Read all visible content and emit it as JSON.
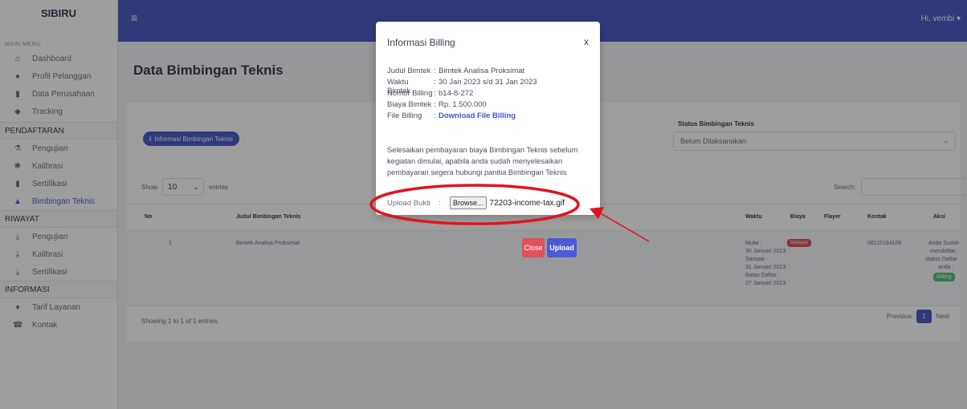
{
  "sidebar": {
    "brand": "SIBIRU",
    "main_menu_label": "MAIN MENU",
    "items_top": [
      {
        "label": "Dashboard",
        "icon": "home-icon"
      },
      {
        "label": "Profil Pelanggan",
        "icon": "user-icon"
      },
      {
        "label": "Data Perusahaan",
        "icon": "building-icon"
      },
      {
        "label": "Tracking",
        "icon": "map-pin-icon"
      }
    ],
    "section_pendaftaran": "PENDAFTARAN",
    "items_pendaftaran": [
      {
        "label": "Pengujian",
        "icon": "flask-icon"
      },
      {
        "label": "Kalibrasi",
        "icon": "cog-icon"
      },
      {
        "label": "Sertifikasi",
        "icon": "certificate-icon"
      },
      {
        "label": "Bimbingan Teknis",
        "icon": "graduation-cap-icon"
      }
    ],
    "section_riwayat": "RIWAYAT",
    "items_riwayat": [
      {
        "label": "Pengujian",
        "icon": "download-icon"
      },
      {
        "label": "Kalibrasi",
        "icon": "download-icon"
      },
      {
        "label": "Sertifikasi",
        "icon": "download-icon"
      }
    ],
    "section_informasi": "INFORMASI",
    "items_informasi": [
      {
        "label": "Tarif Layanan",
        "icon": "pin-icon"
      },
      {
        "label": "Kontak",
        "icon": "phone-icon"
      }
    ]
  },
  "topbar": {
    "user_greeting": "Hi, vembi ▾"
  },
  "page": {
    "title": "Data Bimbingan Teknis",
    "info_button": "Informasi Bimbingan Teknis",
    "status_label": "Status Bimbingan Teknis",
    "status_value": "Belum Dilaksanakan",
    "show_label": "Show",
    "show_value": "10",
    "entries_label": "entries",
    "search_label": "Search:",
    "columns": {
      "no": "No",
      "judul": "Judul Bimbingan Teknis",
      "waktu": "Waktu",
      "biaya": "Biaya",
      "flayer": "Flayer",
      "kontak": "Kontak",
      "aksi": "Aksi"
    },
    "row": {
      "no": "1",
      "judul": "Bimtek Analisa Proksimat",
      "waktu_1": "Mulai :",
      "waktu_2": "30 Januari 2023",
      "waktu_3": "Sampai :",
      "waktu_4": "31 Januari 2023",
      "waktu_5": "Batas Daftar :",
      "waktu_6": "27 Januari 2023",
      "biaya_badge": "Bebayar",
      "kontak": "08115184108",
      "aksi_1": "Anda Sudah",
      "aksi_2": "mendaftar,",
      "aksi_3": "status Daftar",
      "aksi_4": "anda :",
      "aksi_badge": "Billing"
    },
    "showing": "Showing 1 to 1 of 1 entries",
    "pager": {
      "prev": "Previous",
      "current": "1",
      "next": "Next"
    }
  },
  "modal": {
    "title": "Informasi Billing",
    "close_x": "x",
    "fields": [
      {
        "label": "Judul Bimtek",
        "value": "Bimtek Analisa Proksimat"
      },
      {
        "label": "Waktu Bimtek",
        "value": "30 Jan 2023 s/d 31 Jan 2023"
      },
      {
        "label": "Nomor Billing",
        "value": "b14-8-272"
      },
      {
        "label": "Biaya Bimtek",
        "value": "Rp. 1.500.000"
      },
      {
        "label": "File Billing",
        "value": "Download File Billing"
      }
    ],
    "note": "Selesaikan pembayaran biaya Bimbingan Teknis sebelum kegiatan dimulai, apabila anda sudah menyelesaikan pembayaran segera hubungi panitia Bimbingan Teknis",
    "upload_label": "Upload Bukti",
    "browse_label": "Browse...",
    "file_name": "72203-income-tax.gif",
    "close_button": "Close",
    "upload_button": "Upload"
  },
  "colors": {
    "topbar": "#4f5dc7",
    "primary": "#4b5bd6",
    "danger": "#e0525b",
    "success": "#52c27a",
    "annotation": "#e0141e"
  }
}
